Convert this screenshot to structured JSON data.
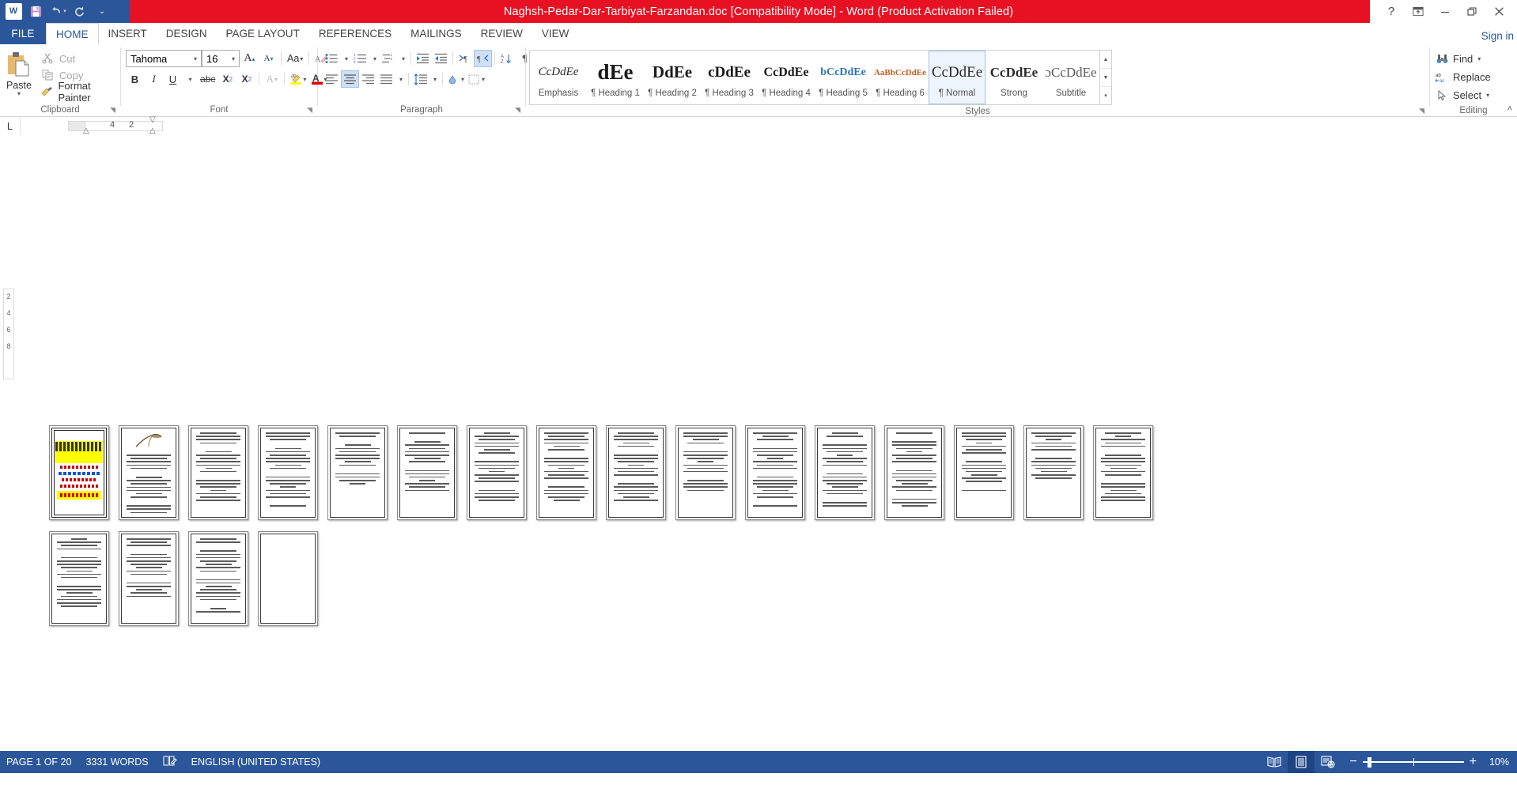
{
  "titlebar": {
    "document_title": "Naghsh-Pedar-Dar-Tarbiyat-Farzandan.doc [Compatibility Mode]  -  Word (Product Activation Failed)",
    "qat": [
      {
        "name": "word-logo-icon",
        "label": "W"
      },
      {
        "name": "save-icon",
        "label": "ὋE"
      },
      {
        "name": "undo-icon",
        "label": "↶"
      },
      {
        "name": "redo-icon",
        "label": "↻"
      },
      {
        "name": "customize-qat-icon",
        "label": "≡"
      }
    ],
    "window_controls": {
      "help": "?",
      "ribbon_display": "ribbon-options",
      "minimize": "—",
      "restore": "restore",
      "close": "✕"
    },
    "accent_color": "#e81123",
    "qat_color": "#2b579a"
  },
  "tabs": {
    "file": "FILE",
    "items": [
      "HOME",
      "INSERT",
      "DESIGN",
      "PAGE LAYOUT",
      "REFERENCES",
      "MAILINGS",
      "REVIEW",
      "VIEW"
    ],
    "active": "HOME",
    "signin": "Sign in"
  },
  "ribbon": {
    "clipboard": {
      "group_label": "Clipboard",
      "paste_label": "Paste",
      "cut_label": "Cut",
      "copy_label": "Copy",
      "format_painter_label": "Format Painter"
    },
    "font": {
      "group_label": "Font",
      "font_name": "Tahoma",
      "font_size": "16",
      "buttons": [
        "grow-font",
        "shrink-font",
        "change-case",
        "clear-formatting",
        "bold",
        "italic",
        "underline",
        "strikethrough",
        "subscript",
        "superscript",
        "text-effects",
        "text-highlight",
        "font-color"
      ],
      "bold_label": "B",
      "italic_label": "I",
      "underline_label": "U",
      "strike_label": "abc",
      "sub_label": "X",
      "super_label": "X",
      "case_label": "Aa",
      "grow_label": "A",
      "shrink_label": "A",
      "effects_label": "A",
      "color_label": "A"
    },
    "paragraph": {
      "group_label": "Paragraph",
      "buttons": [
        "bullets",
        "numbering",
        "multilevel-list",
        "decrease-indent",
        "increase-indent",
        "ltr-text-direction",
        "rtl-text-direction",
        "sort",
        "show-formatting-marks",
        "align-left",
        "center",
        "align-right",
        "justify",
        "line-spacing",
        "shading",
        "borders"
      ],
      "sort_label": "A↓",
      "marks_label": "¶",
      "active_alignment": "center",
      "active_direction": "rtl-text-direction"
    },
    "styles": {
      "group_label": "Styles",
      "items": [
        {
          "preview": "CcDdEe",
          "name": "Emphasis",
          "style": "italic-serif"
        },
        {
          "preview": "dEe",
          "name": "¶ Heading 1",
          "style": "big-bold"
        },
        {
          "preview": "DdEe",
          "name": "¶ Heading 2",
          "style": "bold-serif-lg"
        },
        {
          "preview": "cDdEe",
          "name": "¶ Heading 3",
          "style": "bold-serif-md"
        },
        {
          "preview": "CcDdEe",
          "name": "¶ Heading 4",
          "style": "bold-serif-sm"
        },
        {
          "preview": "bCcDdEe",
          "name": "¶ Heading 5",
          "style": "blue-bold"
        },
        {
          "preview": "AaBbCcDdEe",
          "name": "¶ Heading 6",
          "style": "blue-small"
        },
        {
          "preview": "CcDdEe",
          "name": "¶ Normal",
          "style": "normal",
          "selected": true
        },
        {
          "preview": "CcDdEe",
          "name": "Strong",
          "style": "strong"
        },
        {
          "preview": "ɔCcDdEe",
          "name": "Subtitle",
          "style": "subtitle"
        }
      ]
    },
    "editing": {
      "group_label": "Editing",
      "find_label": "Find",
      "replace_label": "Replace",
      "select_label": "Select"
    },
    "collapse_label": "˄"
  },
  "ruler": {
    "tab_selector": "L",
    "marks": [
      "4",
      "2"
    ]
  },
  "vertical_ruler": {
    "marks": [
      "2",
      "4",
      "6",
      "8"
    ]
  },
  "document": {
    "page_count": 20,
    "cover_page_index": 1,
    "image_page_index": 2,
    "blank_page_index": 20
  },
  "statusbar": {
    "page_indicator": "PAGE 1 OF 20",
    "word_count": "3331 WORDS",
    "proofing_icon": "spellcheck-icon",
    "language": "ENGLISH (UNITED STATES)",
    "views": [
      {
        "name": "read-mode-view-button",
        "active": false
      },
      {
        "name": "print-layout-view-button",
        "active": true
      },
      {
        "name": "web-layout-view-button",
        "active": false
      }
    ],
    "zoom_out": "−",
    "zoom_in": "+",
    "zoom_level": "10%",
    "bar_color": "#2b579a"
  }
}
